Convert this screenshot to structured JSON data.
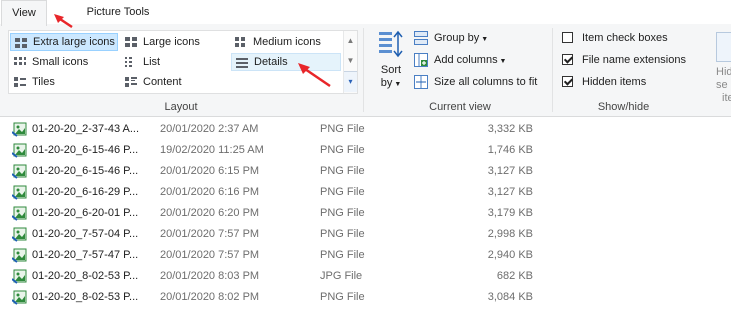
{
  "tabs": {
    "view": "View",
    "picture_tools": "Picture Tools"
  },
  "ribbon": {
    "layout": {
      "label": "Layout",
      "options": {
        "extra_large": "Extra large icons",
        "large": "Large icons",
        "medium": "Medium icons",
        "small": "Small icons",
        "list": "List",
        "details": "Details",
        "tiles": "Tiles",
        "content": "Content"
      },
      "selected": "extra_large"
    },
    "current_view": {
      "label": "Current view",
      "sort_by_line1": "Sort",
      "sort_by_line2": "by",
      "group_by": "Group by",
      "add_columns": "Add columns",
      "size_all_columns": "Size all columns to fit"
    },
    "show_hide": {
      "label": "Show/hide",
      "item_check_boxes": "Item check boxes",
      "item_check_boxes_checked": false,
      "file_name_extensions": "File name extensions",
      "file_name_extensions_checked": true,
      "hidden_items": "Hidden items",
      "hidden_items_checked": true,
      "hide_selected_line1": "Hide se",
      "hide_selected_line2": "ite"
    }
  },
  "files": [
    {
      "name": "01-20-20_2-37-43 A...",
      "date": "20/01/2020 2:37 AM",
      "type": "PNG File",
      "size": "3,332 KB"
    },
    {
      "name": "01-20-20_6-15-46 P...",
      "date": "19/02/2020 11:25 AM",
      "type": "PNG File",
      "size": "1,746 KB"
    },
    {
      "name": "01-20-20_6-15-46 P...",
      "date": "20/01/2020 6:15 PM",
      "type": "PNG File",
      "size": "3,127 KB"
    },
    {
      "name": "01-20-20_6-16-29 P...",
      "date": "20/01/2020 6:16 PM",
      "type": "PNG File",
      "size": "3,127 KB"
    },
    {
      "name": "01-20-20_6-20-01 P...",
      "date": "20/01/2020 6:20 PM",
      "type": "PNG File",
      "size": "3,179 KB"
    },
    {
      "name": "01-20-20_7-57-04 P...",
      "date": "20/01/2020 7:57 PM",
      "type": "PNG File",
      "size": "2,998 KB"
    },
    {
      "name": "01-20-20_7-57-47 P...",
      "date": "20/01/2020 7:57 PM",
      "type": "PNG File",
      "size": "2,940 KB"
    },
    {
      "name": "01-20-20_8-02-53 P...",
      "date": "20/01/2020 8:03 PM",
      "type": "JPG File",
      "size": "682 KB"
    },
    {
      "name": "01-20-20_8-02-53 P...",
      "date": "20/01/2020 8:02 PM",
      "type": "PNG File",
      "size": "3,084 KB"
    }
  ],
  "colors": {
    "annotation_arrow": "#e8262a",
    "selection_fill": "#cce8ff",
    "ribbon_bg": "#f5f6f7",
    "file_icon": "#2f8a3c"
  }
}
